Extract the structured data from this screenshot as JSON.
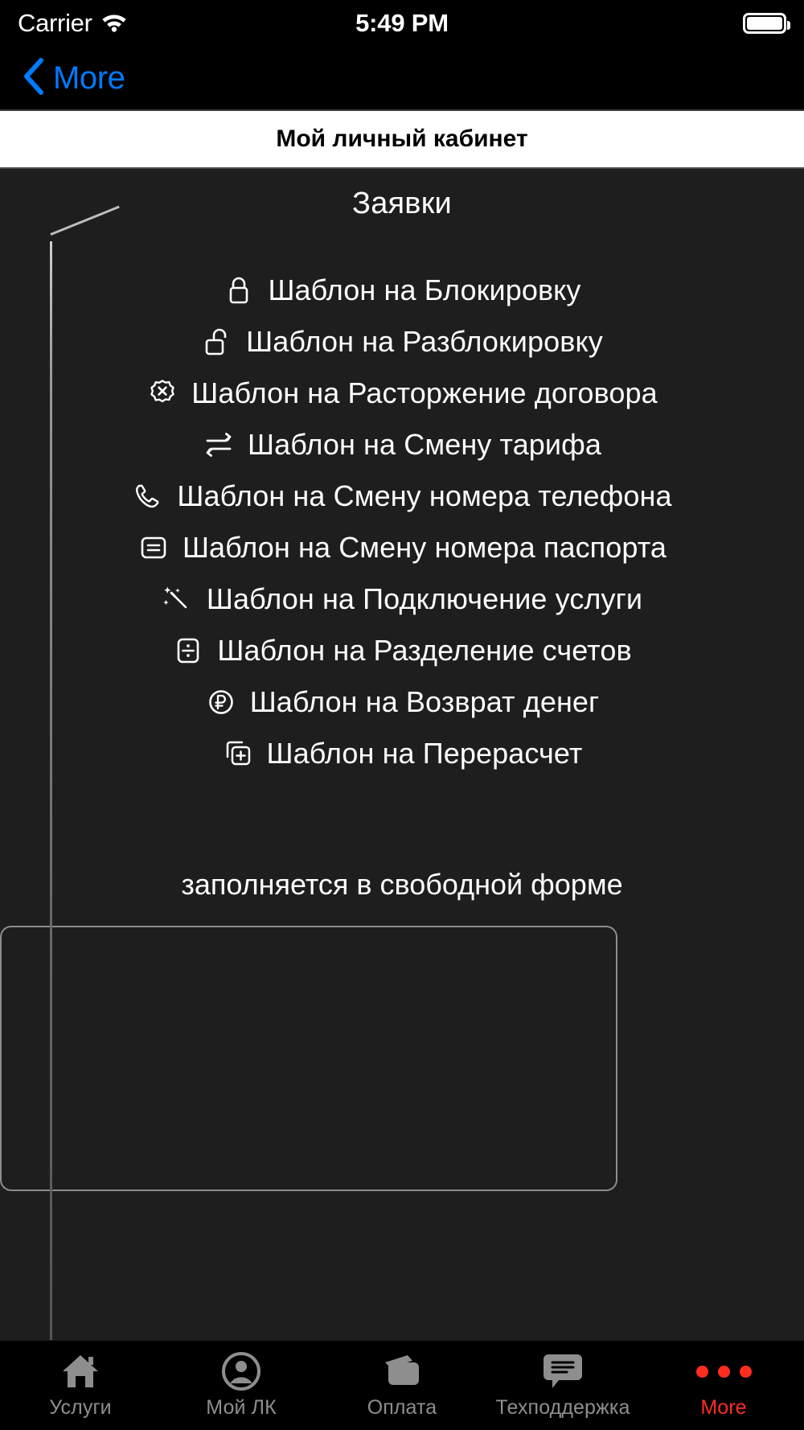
{
  "status_bar": {
    "carrier": "Carrier",
    "wifi_icon": "wifi-icon",
    "time": "5:49 PM",
    "battery_icon": "battery-icon"
  },
  "nav_bar": {
    "back_icon": "chevron-left-icon",
    "back_label": "More",
    "accent_color": "#007AFF"
  },
  "page_header": {
    "title": "Мой личный кабинет"
  },
  "section": {
    "title": "Заявки"
  },
  "templates": [
    {
      "icon": "lock-closed-icon",
      "label": "Шаблон на Блокировку"
    },
    {
      "icon": "lock-open-icon",
      "label": "Шаблон на Разблокировку"
    },
    {
      "icon": "badge-x-icon",
      "label": "Шаблон на Расторжение договора"
    },
    {
      "icon": "swap-arrows-icon",
      "label": "Шаблон на Смену тарифа"
    },
    {
      "icon": "phone-icon",
      "label": "Шаблон на Смену номера телефона"
    },
    {
      "icon": "id-card-icon",
      "label": "Шаблон на Смену номера паспорта"
    },
    {
      "icon": "magic-wand-icon",
      "label": "Шаблон на Подключение услуги"
    },
    {
      "icon": "divide-square-icon",
      "label": "Шаблон на Разделение счетов"
    },
    {
      "icon": "ruble-circle-icon",
      "label": "Шаблон на Возврат денег"
    },
    {
      "icon": "duplicate-plus-icon",
      "label": "Шаблон на Перерасчет"
    }
  ],
  "free_form": {
    "note": "заполняется в свободной форме",
    "value": "",
    "placeholder": ""
  },
  "tab_bar": {
    "active_color": "#FF2D20",
    "inactive_color": "#8E8E8E",
    "tabs": [
      {
        "icon": "home-icon",
        "label": "Услуги",
        "active": false
      },
      {
        "icon": "person-circle-icon",
        "label": "Мой ЛК",
        "active": false
      },
      {
        "icon": "wallet-icon",
        "label": "Оплата",
        "active": false
      },
      {
        "icon": "chat-bubble-icon",
        "label": "Техподдержка",
        "active": false
      },
      {
        "icon": "ellipsis-icon",
        "label": "More",
        "active": true
      }
    ]
  }
}
